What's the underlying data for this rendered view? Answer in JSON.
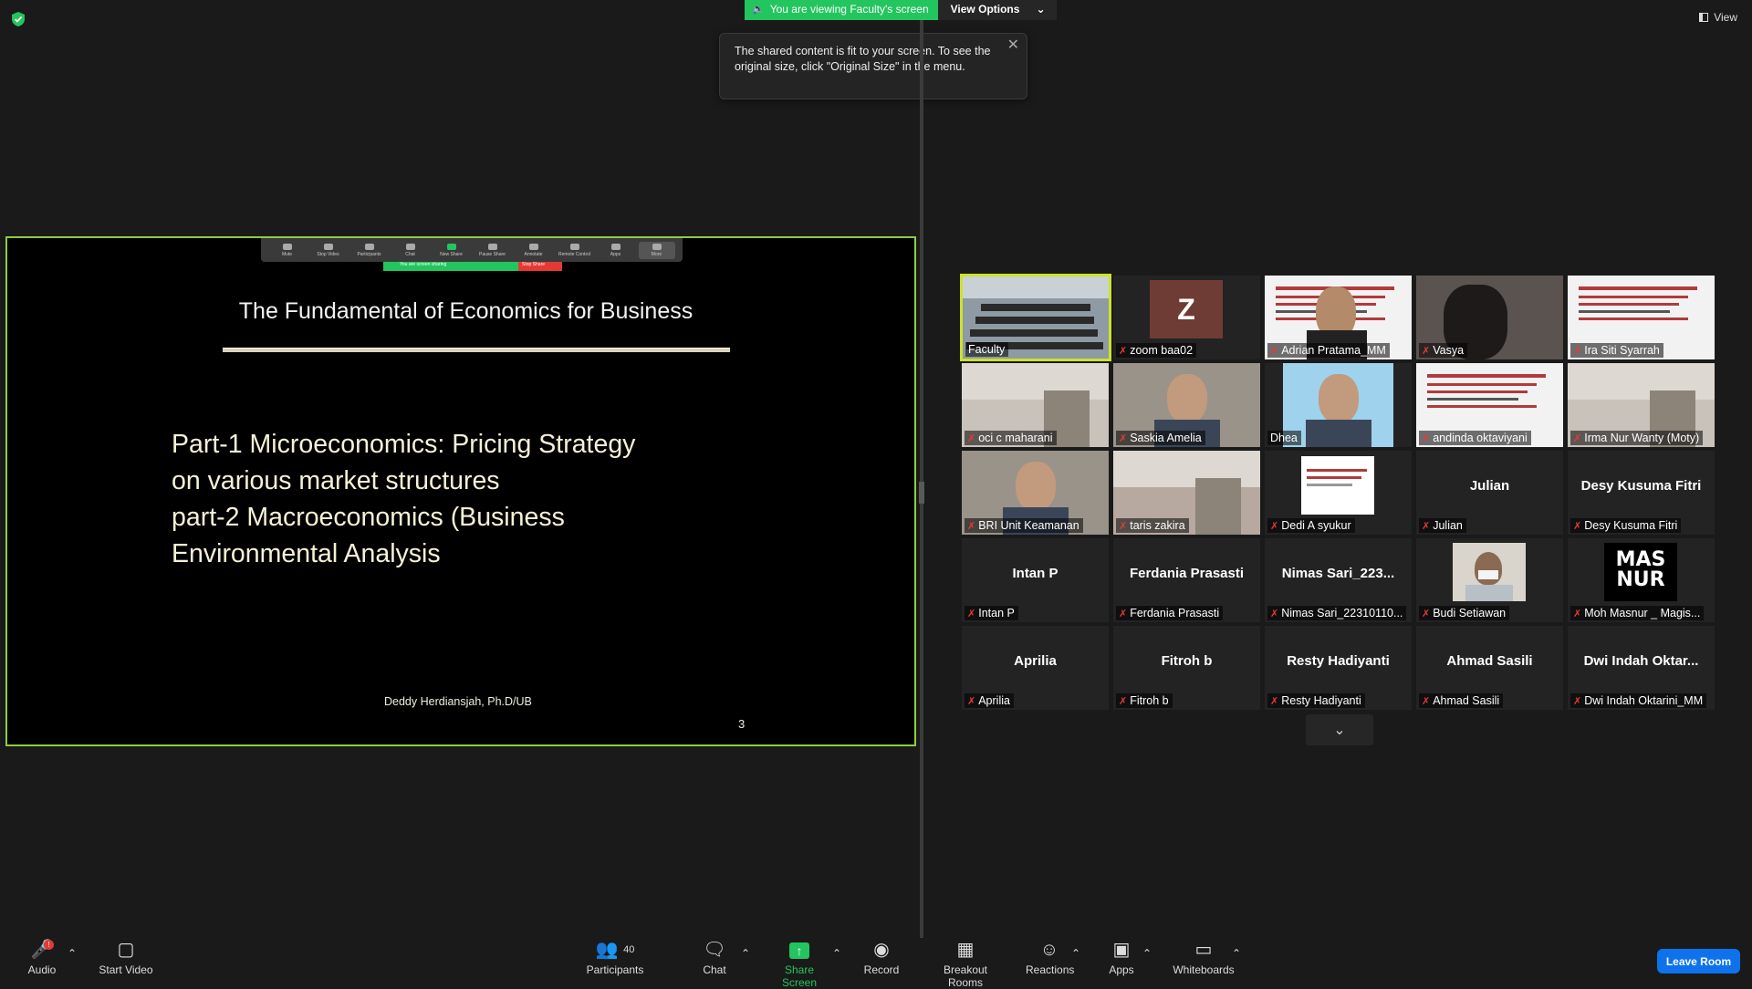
{
  "top": {
    "viewing_banner": "You are viewing Faculty's screen",
    "view_options_label": "View Options",
    "view_label": "View"
  },
  "tooltip": {
    "text": "The shared content is fit to your screen. To see the original size, click \"Original Size\" in the menu."
  },
  "slide": {
    "mini_toolbar": [
      "Mute",
      "Stop Video",
      "Participants",
      "Chat",
      "New Share",
      "Pause Share",
      "Annotate",
      "Remote Control",
      "Apps",
      "More"
    ],
    "mini_participants_count": "40",
    "mini_sharing_text": "You are screen sharing",
    "mini_stop_share": "Stop Share",
    "title": "The Fundamental of Economics for Business",
    "body_lines": [
      "Part-1 Microeconomics: Pricing Strategy",
      "on various market structures",
      "part-2 Macroeconomics (Business",
      "Environmental Analysis"
    ],
    "author": "Deddy Herdiansjah, Ph.D/UB",
    "page_number": "3"
  },
  "gallery": {
    "tiles": [
      {
        "name": "Faculty",
        "big": "",
        "muted": false,
        "kind": "video-classroom",
        "active": true
      },
      {
        "name": "zoom baa02",
        "big": "",
        "muted": true,
        "kind": "avatar-z",
        "initial": "Z"
      },
      {
        "name": "Adrian Pratama_MM",
        "big": "",
        "muted": true,
        "kind": "video-slide-face"
      },
      {
        "name": "Vasya",
        "big": "",
        "muted": true,
        "kind": "video-dark"
      },
      {
        "name": "Ira Siti Syarrah",
        "big": "",
        "muted": true,
        "kind": "video-slide"
      },
      {
        "name": "oci c maharani",
        "big": "",
        "muted": true,
        "kind": "video-room"
      },
      {
        "name": "Saskia Amelia",
        "big": "",
        "muted": true,
        "kind": "video-face"
      },
      {
        "name": "Dhea",
        "big": "",
        "muted": false,
        "kind": "video-face-blue"
      },
      {
        "name": "andinda oktaviyani",
        "big": "",
        "muted": true,
        "kind": "video-slide"
      },
      {
        "name": "Irma Nur Wanty (Moty)",
        "big": "",
        "muted": true,
        "kind": "video-room"
      },
      {
        "name": "BRI Unit Keamanan",
        "big": "",
        "muted": true,
        "kind": "video-face"
      },
      {
        "name": "taris zakira",
        "big": "",
        "muted": true,
        "kind": "video-room2"
      },
      {
        "name": "Dedi A syukur",
        "big": "",
        "muted": true,
        "kind": "video-slide-small"
      },
      {
        "name": "Julian",
        "big": "Julian",
        "muted": true,
        "kind": "none"
      },
      {
        "name": "Desy Kusuma Fitri",
        "big": "Desy Kusuma Fitri",
        "muted": true,
        "kind": "none"
      },
      {
        "name": "Intan P",
        "big": "Intan P",
        "muted": true,
        "kind": "none"
      },
      {
        "name": "Ferdania Prasasti",
        "big": "Ferdania Prasasti",
        "muted": true,
        "kind": "none"
      },
      {
        "name": "Nimas Sari_22310110...",
        "big": "Nimas  Sari_223...",
        "muted": true,
        "kind": "none"
      },
      {
        "name": "Budi Setiawan",
        "big": "",
        "muted": true,
        "kind": "photo"
      },
      {
        "name": "Moh Masnur _ Magis...",
        "big": "",
        "muted": true,
        "kind": "logo-masnur",
        "logo_text": "MAS NUR"
      },
      {
        "name": "Aprilia",
        "big": "Aprilia",
        "muted": true,
        "kind": "none"
      },
      {
        "name": "Fitroh b",
        "big": "Fitroh b",
        "muted": true,
        "kind": "none"
      },
      {
        "name": "Resty Hadiyanti",
        "big": "Resty Hadiyanti",
        "muted": true,
        "kind": "none"
      },
      {
        "name": "Ahmad Sasili",
        "big": "Ahmad Sasili",
        "muted": true,
        "kind": "none"
      },
      {
        "name": "Dwi Indah Oktarini_MM",
        "big": "Dwi  Indah  Oktar...",
        "muted": true,
        "kind": "none"
      }
    ]
  },
  "toolbar": {
    "audio": "Audio",
    "audio_badge": "!",
    "start_video": "Start Video",
    "participants": "Participants",
    "participants_count": "40",
    "chat": "Chat",
    "share_screen": "Share Screen",
    "record": "Record",
    "breakout_rooms": "Breakout Rooms",
    "reactions": "Reactions",
    "apps": "Apps",
    "whiteboards": "Whiteboards",
    "leave_room": "Leave Room"
  },
  "colors": {
    "accent_green": "#23c55e",
    "active_speaker": "#cce22a",
    "share_border": "#8ccf3b",
    "leave_blue": "#0e72ed",
    "muted_red": "#e53935"
  }
}
